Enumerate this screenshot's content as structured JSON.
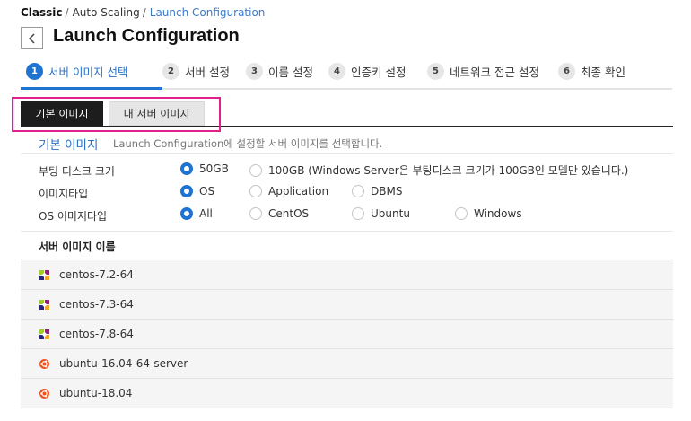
{
  "breadcrumb": {
    "root": "Classic",
    "mid": "Auto Scaling",
    "current": "Launch Configuration",
    "sep": "/"
  },
  "page_title": "Launch Configuration",
  "steps": [
    {
      "num": "1",
      "label": "서버 이미지 선택"
    },
    {
      "num": "2",
      "label": "서버 설정"
    },
    {
      "num": "3",
      "label": "이름 설정"
    },
    {
      "num": "4",
      "label": "인증키 설정"
    },
    {
      "num": "5",
      "label": "네트워크 접근 설정"
    },
    {
      "num": "6",
      "label": "최종 확인"
    }
  ],
  "subtabs": {
    "default": "기본 이미지",
    "mine": "내 서버 이미지"
  },
  "section": {
    "title": "기본 이미지",
    "desc": "Launch Configuration에 설정할 서버 이미지를 선택합니다."
  },
  "options": {
    "disk": {
      "label": "부팅 디스크 크기",
      "a": "50GB",
      "b": "100GB (Windows Server은 부팅디스크 크기가 100GB인 모델만 있습니다.)"
    },
    "type": {
      "label": "이미지타입",
      "a": "OS",
      "b": "Application",
      "c": "DBMS"
    },
    "os": {
      "label": "OS 이미지타입",
      "a": "All",
      "b": "CentOS",
      "c": "Ubuntu",
      "d": "Windows"
    }
  },
  "list_header": "서버 이미지 이름",
  "images": [
    {
      "name": "centos-7.2-64",
      "icon": "centos-icon"
    },
    {
      "name": "centos-7.3-64",
      "icon": "centos-icon"
    },
    {
      "name": "centos-7.8-64",
      "icon": "centos-icon"
    },
    {
      "name": "ubuntu-16.04-64-server",
      "icon": "ubuntu-icon"
    },
    {
      "name": "ubuntu-18.04",
      "icon": "ubuntu-icon"
    }
  ],
  "colors": {
    "accent": "#1f73d1",
    "highlight": "#e0218a",
    "ubuntu": "#e95420"
  }
}
